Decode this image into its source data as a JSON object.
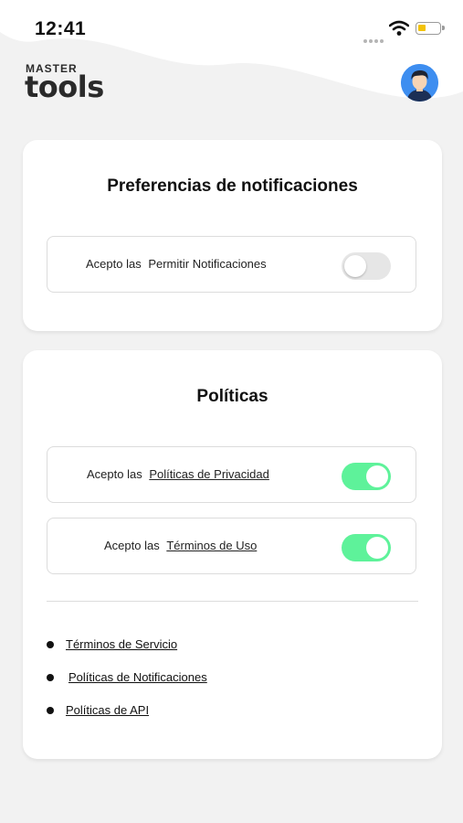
{
  "status_bar": {
    "time": "12:41"
  },
  "header": {
    "logo_top": "MASTER",
    "logo_bottom": "tools"
  },
  "notifications_card": {
    "title": "Preferencias de notificaciones",
    "row": {
      "prefix": "Acepto las",
      "label": "Permitir Notificaciones",
      "enabled": false
    }
  },
  "policies_card": {
    "title": "Políticas",
    "rows": [
      {
        "prefix": "Acepto las",
        "label": "Políticas de Privacidad",
        "enabled": true
      },
      {
        "prefix": "Acepto las",
        "label": "Términos de Uso",
        "enabled": true
      }
    ],
    "links": [
      "Términos de Servicio",
      "Políticas de Notificaciones",
      "Políticas de API"
    ]
  },
  "colors": {
    "toggle_on": "#5ef29a",
    "toggle_off": "#e6e6e6",
    "battery": "#f2c20a",
    "avatar_bg": "#3e8ef0"
  }
}
